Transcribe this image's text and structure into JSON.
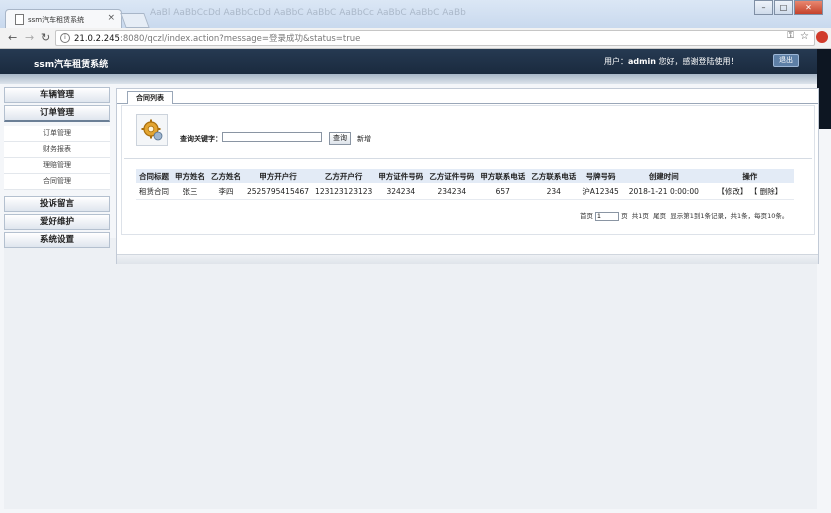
{
  "browser": {
    "tab_title": "ssm汽车租赁系统",
    "tab_close": "×",
    "ribbon_text": "AaBl  AaBbCcDd  AaBbCcDd  AaBbC  AaBbC  AaBbCc  AaBbC  AaBbC  AaBb",
    "url_host": "21.0.2.245",
    "url_rest": ":8080/qczl/index.action?message=登录成功&status=true",
    "icons": {
      "back": "back-arrow-icon",
      "forward": "forward-arrow-icon",
      "reload": "reload-icon"
    }
  },
  "header": {
    "app_title": "ssm汽车租赁系统",
    "user_prefix": "用户：",
    "username": "admin",
    "greeting": " 您好，感谢登陆使用！",
    "logout_label": "退出"
  },
  "sidebar": {
    "menus": [
      {
        "label": "车辆管理",
        "open": false
      },
      {
        "label": "订单管理",
        "open": true,
        "items": [
          "订单管理",
          "财务报表",
          "理赔管理",
          "合同管理"
        ]
      },
      {
        "label": "投诉留言",
        "open": false
      },
      {
        "label": "爱好维护",
        "open": false
      },
      {
        "label": "系统设置",
        "open": false
      }
    ]
  },
  "main": {
    "tab_label": "合同列表",
    "search": {
      "label": "查询关键字：",
      "value": "",
      "button_label": "查询",
      "add_label": "新增"
    },
    "table": {
      "headers": [
        "合同标题",
        "甲方姓名",
        "乙方姓名",
        "甲方开户行",
        "乙方开户行",
        "甲方证件号码",
        "乙方证件号码",
        "甲方联系电话",
        "乙方联系电话",
        "号牌号码",
        "创建时间",
        "操作"
      ],
      "rows": [
        [
          "租赁合同",
          "张三",
          "李四",
          "2525795415467",
          "123123123123",
          "324234",
          "234234",
          "657",
          "234",
          "沪A12345",
          "2018-1-21 0:00:00"
        ]
      ],
      "actions": [
        "【修改】",
        "【 删除】"
      ]
    },
    "pager": {
      "first": "首页",
      "page_value": "1",
      "page_suffix": "页",
      "total_pages": "共1页",
      "last": "尾页",
      "summary": "显示第1到1条记录，共1条，每页10条。"
    }
  }
}
